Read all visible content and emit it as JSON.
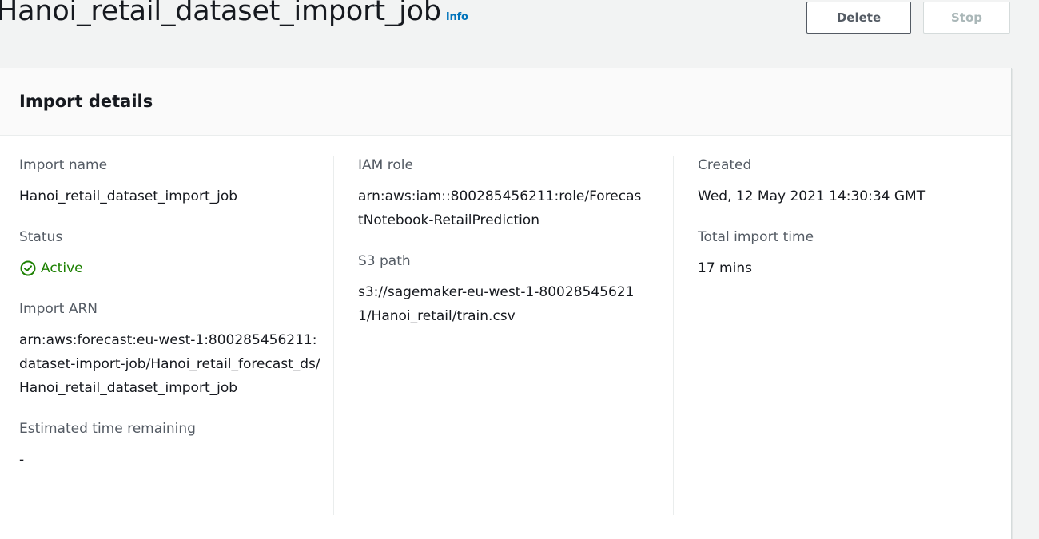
{
  "header": {
    "title": "Hanoi_retail_dataset_import_job",
    "info_label": "Info",
    "delete_label": "Delete",
    "stop_label": "Stop"
  },
  "card": {
    "title": "Import details"
  },
  "fields": {
    "import_name": {
      "label": "Import name",
      "value": "Hanoi_retail_dataset_import_job"
    },
    "status": {
      "label": "Status",
      "value": "Active",
      "icon": "check-circle-icon",
      "color": "#1d8102"
    },
    "import_arn": {
      "label": "Import ARN",
      "value": "arn:aws:forecast:eu-west-1:800285456211:dataset-import-job/Hanoi_retail_forecast_ds/Hanoi_retail_dataset_import_job"
    },
    "estimated_time_remaining": {
      "label": "Estimated time remaining",
      "value": "-"
    },
    "iam_role": {
      "label": "IAM role",
      "value": "arn:aws:iam::800285456211:role/ForecastNotebook-RetailPrediction"
    },
    "s3_path": {
      "label": "S3 path",
      "value": "s3://sagemaker-eu-west-1-800285456211/Hanoi_retail/train.csv"
    },
    "created": {
      "label": "Created",
      "value": "Wed, 12 May 2021 14:30:34 GMT"
    },
    "total_import_time": {
      "label": "Total import time",
      "value": "17 mins"
    }
  },
  "colors": {
    "link": "#0073bb",
    "success": "#1d8102",
    "background": "#f2f3f3"
  }
}
